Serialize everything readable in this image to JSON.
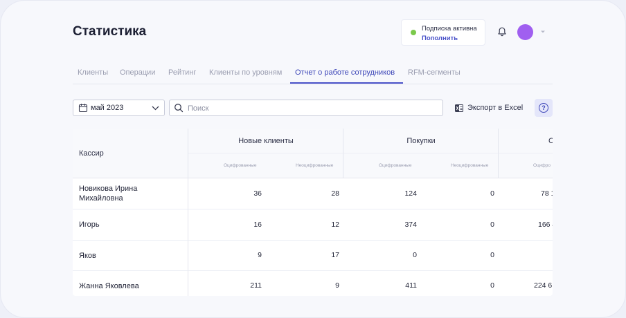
{
  "page": {
    "title": "Статистика"
  },
  "subscription": {
    "status": "Подписка активна",
    "action": "Пополнить",
    "status_color": "#7bc94b"
  },
  "header": {
    "avatar_color": "#a05ff0"
  },
  "tabs": [
    {
      "label": "Клиенты",
      "active": false
    },
    {
      "label": "Операции",
      "active": false
    },
    {
      "label": "Рейтинг",
      "active": false
    },
    {
      "label": "Клиенты по уровням",
      "active": false
    },
    {
      "label": "Отчет о работе сотрудников",
      "active": true
    },
    {
      "label": "RFM-сегменты",
      "active": false
    }
  ],
  "filters": {
    "date_value": "май 2023",
    "search_placeholder": "Поиск",
    "search_value": "",
    "export_label": "Экспорт в Excel",
    "help_symbol": "?"
  },
  "table": {
    "cashier_header": "Кассир",
    "groups": [
      "Новые клиенты",
      "Покупки",
      "С"
    ],
    "subheaders": [
      "Оцифрованные",
      "Неоцифрованные",
      "Оцифрованные",
      "Неоцифрованные",
      "Оцифро"
    ],
    "rows": [
      {
        "cashier": "Новикова Ирина Михайловна",
        "new_digitized": "36",
        "new_undigitized": "28",
        "purchases_digitized": "124",
        "purchases_undigitized": "0",
        "sum_digitized": "78 1!"
      },
      {
        "cashier": "Игорь",
        "new_digitized": "16",
        "new_undigitized": "12",
        "purchases_digitized": "374",
        "purchases_undigitized": "0",
        "sum_digitized": "166 4"
      },
      {
        "cashier": "Яков",
        "new_digitized": "9",
        "new_undigitized": "17",
        "purchases_digitized": "0",
        "purchases_undigitized": "0",
        "sum_digitized": ""
      },
      {
        "cashier": "Жанна Яковлева",
        "new_digitized": "211",
        "new_undigitized": "9",
        "purchases_digitized": "411",
        "purchases_undigitized": "0",
        "sum_digitized": "224 6"
      }
    ]
  },
  "colors": {
    "accent": "#4a52c9",
    "background": "#f7f8fc"
  }
}
